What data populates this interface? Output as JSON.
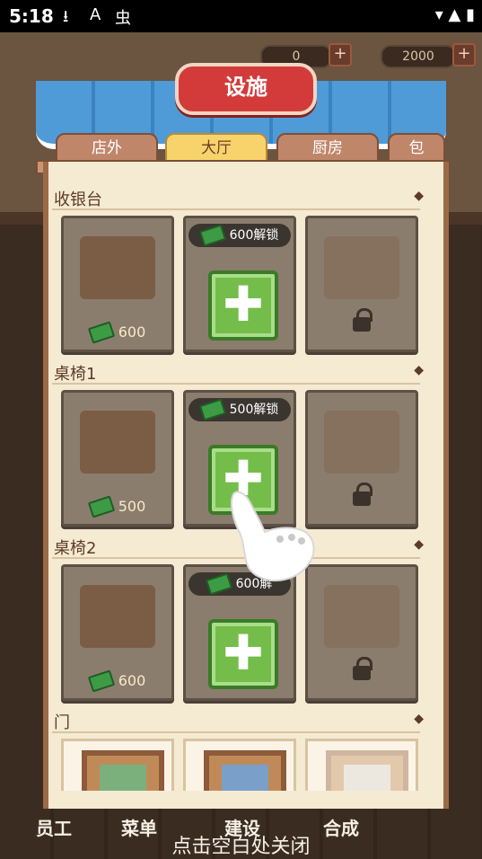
{
  "status_bar": {
    "time": "5:18",
    "icons": [
      "download-icon",
      "a-icon",
      "bug-icon"
    ],
    "right_icons": [
      "wifi-icon",
      "signal-icon",
      "battery-icon"
    ]
  },
  "currency": {
    "left_value": "0",
    "right_value": "2000"
  },
  "modal": {
    "title": "设施",
    "tabs": [
      "店外",
      "大厅",
      "厨房",
      "包"
    ],
    "active_tab": "大厅",
    "sections": [
      {
        "title": "收银台",
        "cards": [
          {
            "type": "owned",
            "price": "600"
          },
          {
            "type": "unlock",
            "unlock_text": "600解锁"
          },
          {
            "type": "locked"
          }
        ]
      },
      {
        "title": "桌椅1",
        "cards": [
          {
            "type": "owned",
            "price": "500"
          },
          {
            "type": "unlock",
            "unlock_text": "500解锁"
          },
          {
            "type": "locked"
          }
        ]
      },
      {
        "title": "桌椅2",
        "cards": [
          {
            "type": "owned",
            "price": "600"
          },
          {
            "type": "unlock",
            "unlock_text": "600解"
          },
          {
            "type": "locked"
          }
        ]
      },
      {
        "title": "门",
        "cards": [
          {
            "type": "door"
          },
          {
            "type": "door"
          },
          {
            "type": "door"
          }
        ]
      }
    ]
  },
  "bottom_nav": {
    "items": [
      "员工",
      "菜单",
      "建设",
      "合成"
    ]
  },
  "hint": "点击空白处关闭",
  "colors": {
    "accent_red": "#d33b3b",
    "tab_active": "#f8d36b",
    "plus_green": "#74bd4a",
    "panel_bg": "#f5ead2"
  }
}
